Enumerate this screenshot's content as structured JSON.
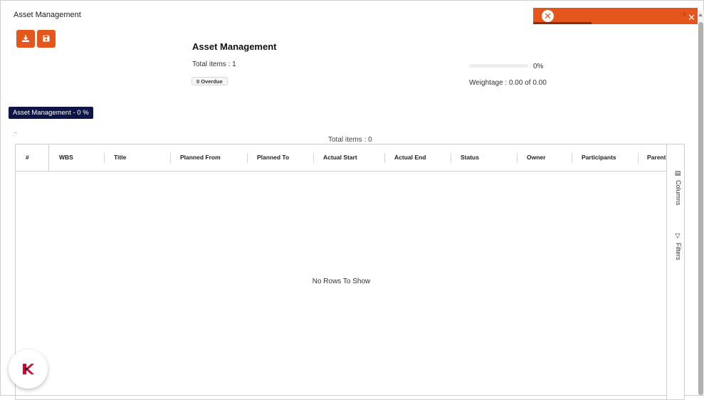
{
  "window": {
    "title": "Asset Management"
  },
  "toast": {
    "status_icon": "error-x-icon",
    "close_icon": "close-icon",
    "pin_icon": "pin-icon",
    "color": "#e4561b"
  },
  "toolbar": {
    "download_icon": "download-icon",
    "save_icon": "save-icon",
    "accent": "#e4561b"
  },
  "summary": {
    "title": "Asset Management",
    "total_items": "Total items : 1",
    "overdue": "0 Overdue",
    "progress_percent": 0,
    "progress_label": "0%",
    "weightage": "Weightage : 0.00 of 0.00"
  },
  "group": {
    "badge": "Asset Management - 0 %",
    "color": "#0e1445",
    "marker": "."
  },
  "grid": {
    "total_items": "Total items : 0",
    "columns": [
      "#",
      "WBS",
      "Title",
      "Planned From",
      "Planned To",
      "Actual Start",
      "Actual End",
      "Status",
      "Owner",
      "Participants",
      "Parent"
    ],
    "rows": [],
    "empty_text": "No Rows To Show",
    "side_tabs": [
      {
        "label": "Columns",
        "icon": "columns-icon"
      },
      {
        "label": "Filters",
        "icon": "filter-icon"
      }
    ]
  },
  "app_logo": {
    "icon": "app-logo-icon",
    "color": "#c8102e"
  }
}
